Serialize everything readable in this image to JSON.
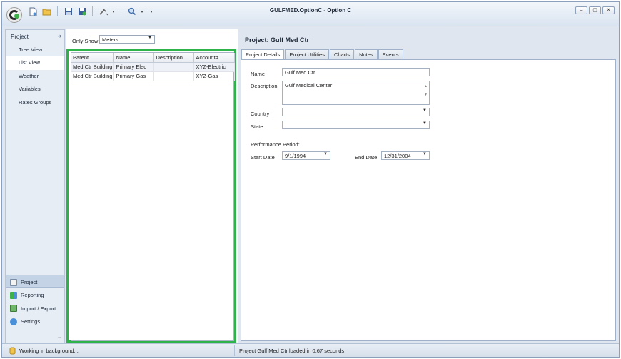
{
  "window": {
    "title": "GULFMED.OptionC - Option C"
  },
  "quick_access": {
    "items": [
      "new-file-icon",
      "open-folder-icon",
      "save-icon",
      "save-as-icon",
      "tools-icon",
      "search-icon",
      "dropdown-icon"
    ]
  },
  "window_controls": {
    "minimize": "–",
    "restore": "▢",
    "close": "✕"
  },
  "nav": {
    "header": "Project",
    "collapse": "«",
    "items": [
      {
        "label": "Tree View"
      },
      {
        "label": "List View"
      },
      {
        "label": "Weather"
      },
      {
        "label": "Variables"
      },
      {
        "label": "Rates Groups"
      }
    ],
    "bottom": [
      {
        "label": "Project",
        "icon": "project-icon"
      },
      {
        "label": "Reporting",
        "icon": "reporting-icon"
      },
      {
        "label": "Import / Export",
        "icon": "import-export-icon"
      },
      {
        "label": "Settings",
        "icon": "settings-icon"
      }
    ],
    "more": "⌄"
  },
  "list": {
    "only_show_label": "Only Show",
    "only_show_value": "Meters",
    "columns": [
      "Parent",
      "Name",
      "Description",
      "Account#"
    ],
    "rows": [
      [
        "Med Ctr Building",
        "Primary Elec",
        "",
        "XYZ-Electric"
      ],
      [
        "Med Ctr Building",
        "Primary Gas",
        "",
        "XYZ-Gas"
      ]
    ]
  },
  "project": {
    "title": "Project:  Gulf Med Ctr",
    "tabs": [
      "Project Details",
      "Project Utilities",
      "Charts",
      "Notes",
      "Events"
    ],
    "fields": {
      "name_label": "Name",
      "name_value": "Gulf Med Ctr",
      "description_label": "Description",
      "description_value": "Gulf Medical Center",
      "country_label": "Country",
      "country_value": "",
      "state_label": "State",
      "state_value": "",
      "performance_label": "Performance Period:",
      "start_label": "Start Date",
      "start_value": "9/1/1994",
      "end_label": "End Date",
      "end_value": "12/31/2004"
    }
  },
  "status": {
    "left": "Working in background...",
    "right": "Project Gulf Med Ctr loaded in 0.67 seconds"
  },
  "colors": {
    "highlight_frame": "#2db34a"
  }
}
